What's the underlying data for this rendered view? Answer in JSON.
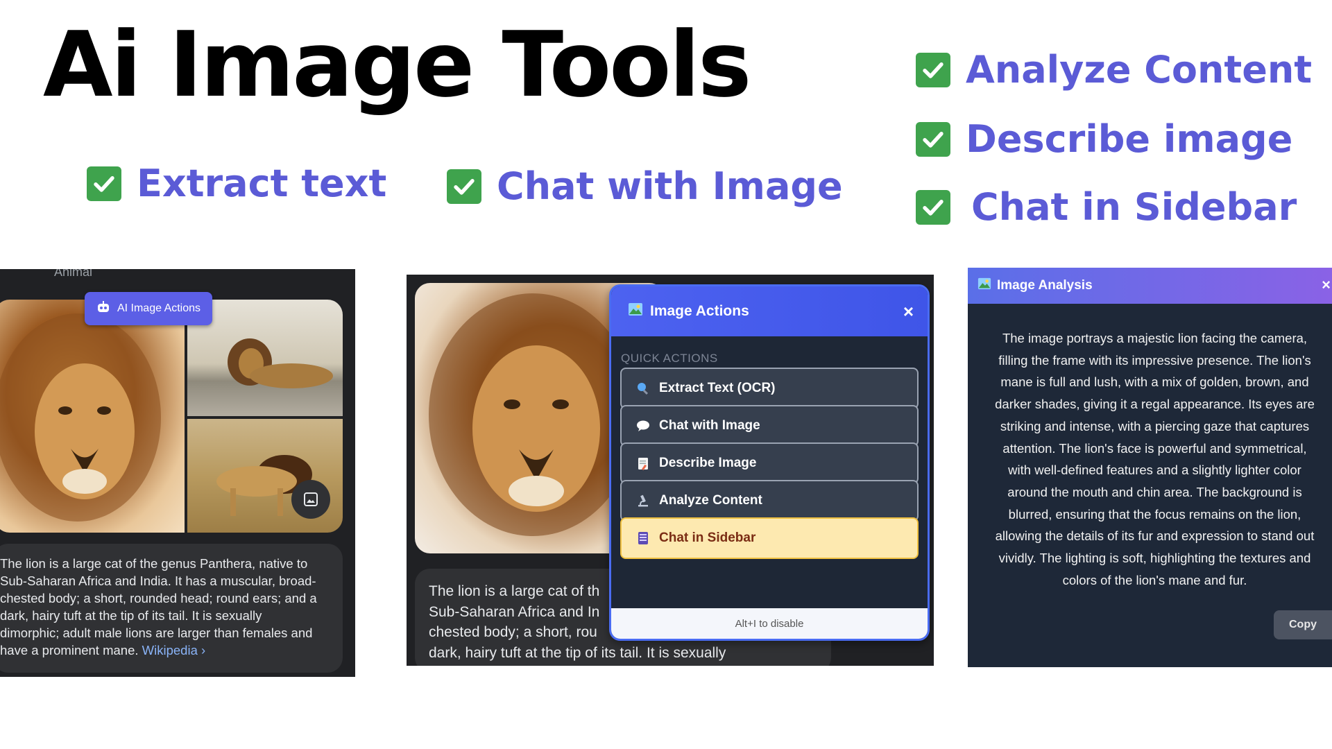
{
  "title": "Ai Image Tools",
  "features": {
    "extract_text": "Extract text",
    "chat_with_image": "Chat with Image",
    "analyze_content": "Analyze Content",
    "describe_image": "Describe image",
    "chat_in_sidebar": "Chat in Sidebar"
  },
  "colors": {
    "feature_text": "#5b5bd6",
    "check_green": "#3fa34d",
    "actions_header": "#4d62f0",
    "highlight_button": "#fde9b0"
  },
  "panel1": {
    "top_label": "Animal",
    "badge_label": "AI Image Actions",
    "description_lines": [
      "The lion is a large cat of the genus Panthera, native to",
      "Sub-Saharan Africa and India. It has a muscular, broad-",
      "chested body; a short, rounded head; round ears; and a",
      "dark, hairy tuft at the tip of its tail. It is sexually",
      "dimorphic; adult male lions are larger than females and",
      "have a prominent mane."
    ],
    "wiki_link": "Wikipedia ›"
  },
  "panel2": {
    "description_lines": [
      "The lion is a large cat of th",
      "Sub-Saharan Africa and In",
      "chested body; a short, rou",
      "dark, hairy tuft at the tip of its tail. It is sexually"
    ],
    "popup": {
      "title": "Image Actions",
      "close": "×",
      "section_label": "QUICK ACTIONS",
      "buttons": [
        {
          "label": "Extract Text (OCR)",
          "icon": "magnifier-icon"
        },
        {
          "label": "Chat with Image",
          "icon": "speech-bubble-icon"
        },
        {
          "label": "Describe Image",
          "icon": "memo-icon"
        },
        {
          "label": "Analyze Content",
          "icon": "microscope-icon"
        },
        {
          "label": "Chat in Sidebar",
          "icon": "sidebar-icon"
        }
      ],
      "footer": "Alt+I to disable"
    }
  },
  "panel3": {
    "title": "Image Analysis",
    "close": "×",
    "body_lines": [
      "The image portrays a majestic lion facing the camera,",
      "filling the frame with its impressive presence. The lion's",
      "mane is full and lush, with a mix of golden, brown, and",
      "darker shades, giving it a regal appearance. Its eyes are",
      "striking and intense, with a piercing gaze that captures",
      "attention. The lion's face is powerful and symmetrical,",
      "with well-defined features and a slightly lighter color",
      "around the mouth and chin area. The background is",
      "blurred, ensuring that the focus remains on the lion,",
      "allowing the details of its fur and expression to stand out",
      "vividly. The lighting is soft, highlighting the textures and",
      "colors of the lion's mane and fur."
    ],
    "copy_label": "Copy"
  }
}
